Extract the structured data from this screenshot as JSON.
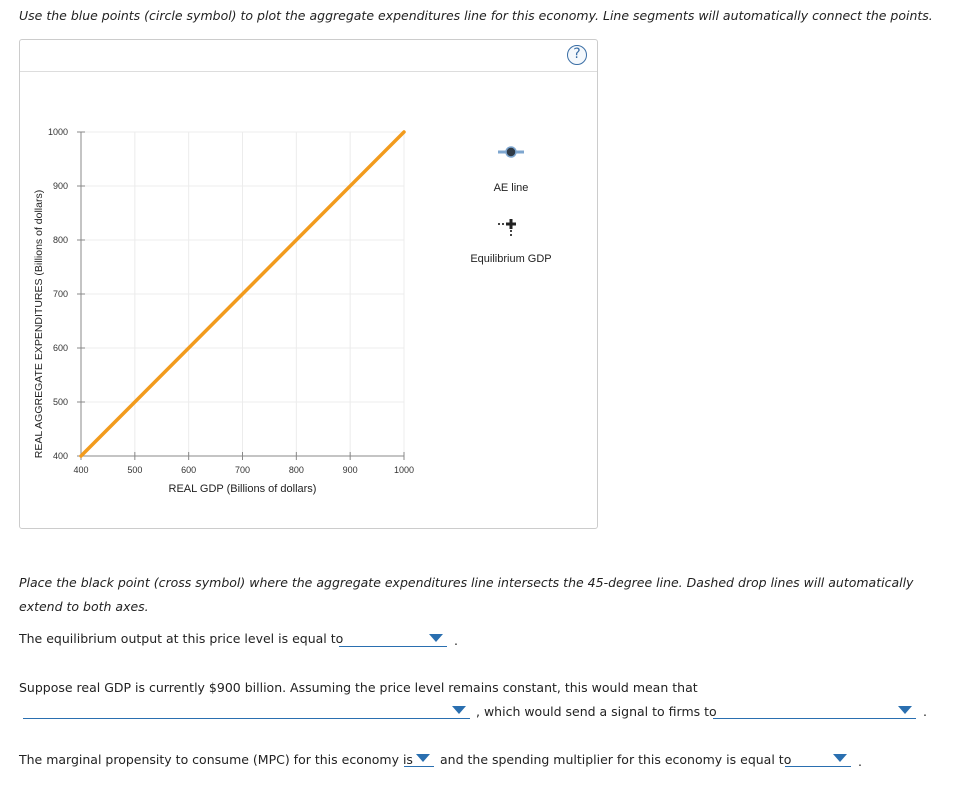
{
  "instructions": {
    "plot_ae": "Use the blue points (circle symbol) to plot the aggregate expenditures line for this economy. Line segments will automatically connect the points.",
    "place_point": "Place the black point (cross symbol) where the aggregate expenditures line intersects the 45-degree line. Dashed drop lines will automatically extend to both axes."
  },
  "help_label": "?",
  "chart_data": {
    "type": "line",
    "xlabel": "REAL GDP (Billions of dollars)",
    "ylabel": "REAL AGGREGATE EXPENDITURES (Billions of dollars)",
    "xlim": [
      400,
      1000
    ],
    "ylim": [
      400,
      1000
    ],
    "x_ticks": [
      "400",
      "500",
      "600",
      "700",
      "800",
      "900",
      "1000"
    ],
    "y_ticks": [
      "400",
      "500",
      "600",
      "700",
      "800",
      "900",
      "1000"
    ],
    "grid": true,
    "series": [
      {
        "x": [
          400,
          1000
        ],
        "y": [
          400,
          1000
        ],
        "color": "#f29b1d"
      }
    ],
    "legend": [
      {
        "label": "AE line",
        "symbol": "circle",
        "color": "#2f3a46",
        "line_color": "#7ea6cf"
      },
      {
        "label": "Equilibrium GDP",
        "symbol": "cross",
        "color": "#222222"
      }
    ]
  },
  "questions": {
    "q1_text": "The equilibrium output at this price level is equal to",
    "q1_value": "",
    "q2_text": "Suppose real GDP is currently $900 billion. Assuming the price level remains constant, this would mean that",
    "q2_value": "",
    "q2_mid": ", which would send a signal to firms to",
    "q2b_value": "",
    "q3_text": "The marginal propensity to consume (MPC) for this economy is",
    "q3_value": "",
    "q3_mid": "and the spending multiplier for this economy is equal to",
    "q3b_value": "",
    "period": "."
  }
}
